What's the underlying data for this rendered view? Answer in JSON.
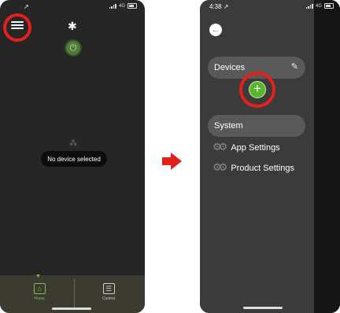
{
  "left_phone": {
    "status_time": "↗",
    "status_network": "4G",
    "bluetooth_icon": "✱",
    "power_icon": "⏻",
    "spinner_icon": "⁂",
    "toast_text": "No device selected",
    "tabs": [
      {
        "label": "Home",
        "icon": "home-icon",
        "active": true,
        "color": "#7bbf4a"
      },
      {
        "label": "Control",
        "icon": "sliders-icon",
        "active": false,
        "color": "#cfcfcf"
      }
    ]
  },
  "right_phone": {
    "status_time": "4:38 ↗",
    "status_network": "4G",
    "back_icon": "←",
    "devices_label": "Devices",
    "edit_icon": "✎",
    "add_icon": "+",
    "system_label": "System",
    "menu_items": [
      {
        "label": "App Settings",
        "icon": "gears-icon"
      },
      {
        "label": "Product Settings",
        "icon": "gears-icon"
      }
    ]
  },
  "colors": {
    "highlight_ring": "#e3201b",
    "accent_green": "#5ab52e",
    "arrow": "#e3201b"
  }
}
